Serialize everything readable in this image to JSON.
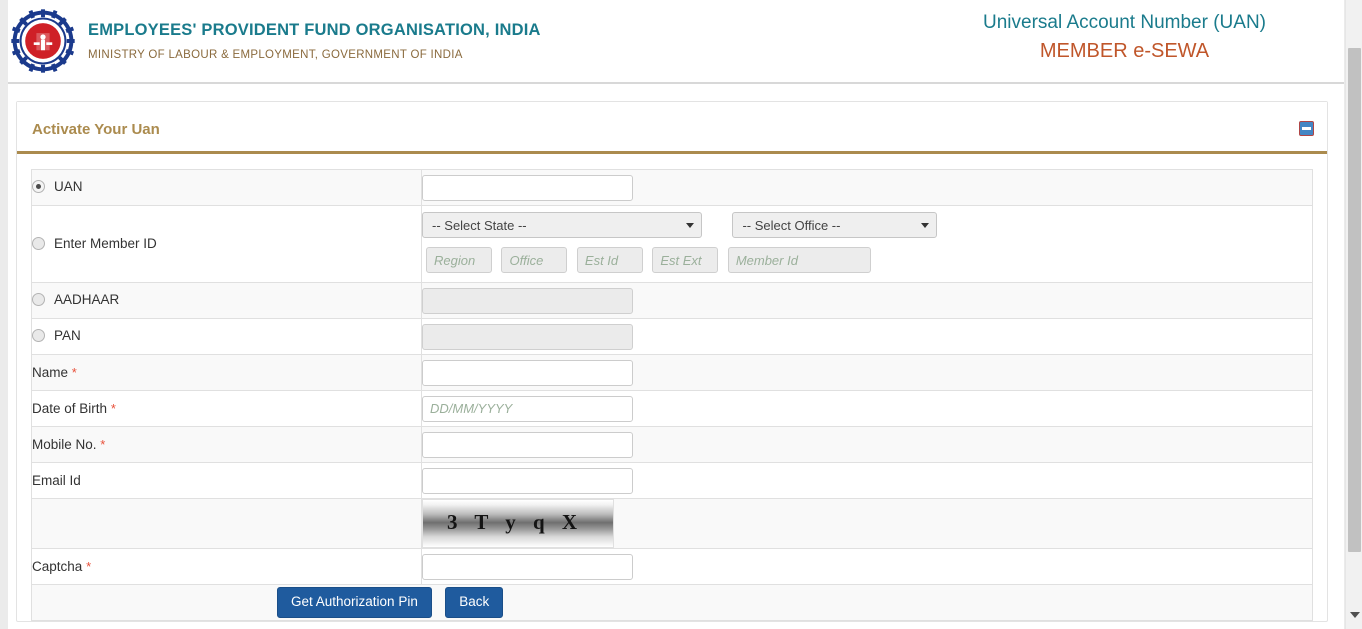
{
  "header": {
    "org_name": "EMPLOYEES' PROVIDENT FUND ORGANISATION, INDIA",
    "ministry": "MINISTRY OF LABOUR & EMPLOYMENT, GOVERNMENT OF INDIA",
    "uan_title": "Universal Account Number (UAN)",
    "esewa_title": "MEMBER e-SEWA",
    "logo_alt": "epfo-logo",
    "colors": {
      "teal": "#1a7b8c",
      "brown": "#8a6a3d",
      "orange": "#c0562a",
      "gold": "#ab8b4e",
      "button_blue": "#1f5b9e"
    }
  },
  "panel": {
    "title": "Activate Your Uan",
    "collapse_icon": "minus-icon"
  },
  "form": {
    "rows": [
      {
        "label": "UAN",
        "type": "radio",
        "checked": true
      },
      {
        "label": "Enter Member ID",
        "type": "radio",
        "checked": false
      },
      {
        "label": "AADHAAR",
        "type": "radio",
        "checked": false
      },
      {
        "label": "PAN",
        "type": "radio",
        "checked": false
      },
      {
        "label": "Name",
        "required": true
      },
      {
        "label": "Date of Birth",
        "required": true
      },
      {
        "label": "Mobile No.",
        "required": true
      },
      {
        "label": "Email Id",
        "required": false
      },
      {
        "label": "Captcha",
        "required": true
      }
    ],
    "required_marker": "*",
    "uan_value": "",
    "state_select": "-- Select State --",
    "office_select": "-- Select Office --",
    "member_fields": [
      {
        "name": "region",
        "placeholder": "Region",
        "value": ""
      },
      {
        "name": "office",
        "placeholder": "Office",
        "value": ""
      },
      {
        "name": "est-id",
        "placeholder": "Est Id",
        "value": ""
      },
      {
        "name": "est-ext",
        "placeholder": "Est Ext",
        "value": ""
      },
      {
        "name": "member-id",
        "placeholder": "Member Id",
        "value": ""
      }
    ],
    "aadhaar_value": "",
    "pan_value": "",
    "name_value": "",
    "dob_value": "",
    "dob_placeholder": "DD/MM/YYYY",
    "mobile_value": "",
    "email_value": "",
    "captcha_text": "3 T y q X",
    "captcha_value": ""
  },
  "buttons": {
    "submit": "Get Authorization Pin",
    "back": "Back"
  }
}
